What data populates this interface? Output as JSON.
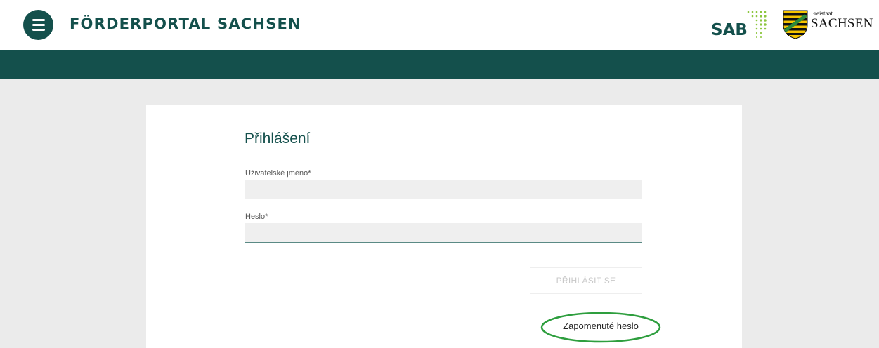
{
  "header": {
    "portal_title": "FÖRDERPORTAL SACHSEN",
    "sab_logo_text": "SAB",
    "sachsen_logo_small": "Freistaat",
    "sachsen_logo_big": "SACHSEN"
  },
  "login": {
    "title": "Přihlášení",
    "username_label": "Uživatelské jméno*",
    "username_value": "",
    "password_label": "Heslo*",
    "password_value": "",
    "submit_label": "PŘIHLÁSIT SE",
    "forgot_label": "Zapomenuté heslo"
  },
  "colors": {
    "brand_dark_green": "#14504c",
    "light_green": "#8cc63e",
    "highlight_green": "#2e9e3e",
    "background": "#ebebeb"
  },
  "icons": {
    "menu": "hamburger-menu-icon",
    "sab_dots": "dot-grid-icon",
    "sachsen_shield": "sachsen-coat-of-arms-icon"
  }
}
